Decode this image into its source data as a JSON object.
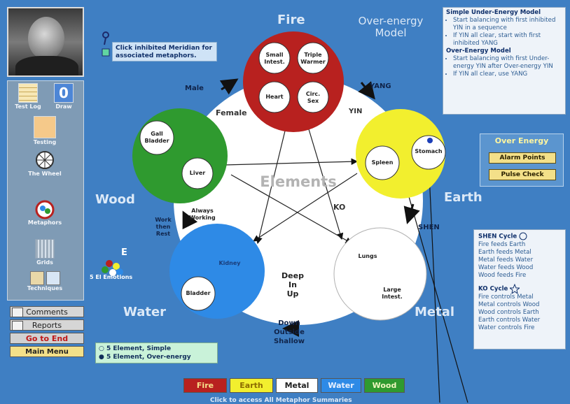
{
  "sidebar": {
    "tools": {
      "test_log": "Test Log",
      "draw": "Draw",
      "testing": "Testing",
      "the_wheel": "The Wheel",
      "metaphors": "Metaphors",
      "grids": "Grids",
      "techniques": "Techniques"
    },
    "emotions_label": "5 El Emotions",
    "emotions_badge": "E",
    "buttons": {
      "comments": "Comments",
      "reports": "Reports",
      "go_to_end": "Go to End",
      "main_menu": "Main Menu"
    }
  },
  "hint_note": "Click inhibited Meridian for associated metaphors.",
  "model_title": "Over-energy\nModel",
  "model_box": {
    "under_title": "Simple Under-Energy Model",
    "under_items": [
      "Start balancing with first inhibited YIN in a sequence",
      "If YIN all clear, start with first inhibited YANG"
    ],
    "over_title": "Over-Energy Model",
    "over_items": [
      "Start balancing with first Under-energy YIN after Over-energy YIN",
      "If YIN all clear, use YANG"
    ]
  },
  "over_energy": {
    "title": "Over Energy",
    "alarm": "Alarm Points",
    "pulse": "Pulse Check"
  },
  "cycle_box": {
    "shen_title": "SHEN Cycle",
    "shen_items": [
      "Fire feeds Earth",
      "Earth feeds Metal",
      "Metal feeds Water",
      "Water feeds Wood",
      "Wood feeds Fire"
    ],
    "ko_title": "KO Cycle",
    "ko_items": [
      "Fire controls Metal",
      "Metal controls Wood",
      "Wood controls Earth",
      "Earth controls Water",
      "Water controls Fire"
    ]
  },
  "wheel": {
    "center": "Elements",
    "elements": {
      "fire": "Fire",
      "earth": "Earth",
      "metal": "Metal",
      "water": "Water",
      "wood": "Wood"
    },
    "meridians": {
      "small_intestine": "Small\nIntest.",
      "triple_warmer": "Triple\nWarmer",
      "heart": "Heart",
      "circ_sex": "Circ.\nSex",
      "stomach": "Stomach",
      "spleen": "Spleen",
      "lungs": "Lungs",
      "large_intestine": "Large\nIntest.",
      "kidney": "Kidney",
      "bladder": "Bladder",
      "gall_bladder": "Gall\nBladder",
      "liver": "Liver"
    },
    "labels": {
      "male": "Male",
      "female": "Female",
      "yang": "YANG",
      "yin": "YIN",
      "ko": "KO",
      "shen": "SHEN",
      "always_working": "Always\nWorking",
      "work_then_rest": "Work\nthen\nRest",
      "deep_in_up": "Deep\nIn\nUp",
      "down_outside_shallow": "Down\nOutside\nShallow"
    }
  },
  "radio": {
    "simple": "5 Element, Simple",
    "over": "5 Element, Over-energy",
    "selected": "over"
  },
  "element_buttons": {
    "fire": "Fire",
    "earth": "Earth",
    "metal": "Metal",
    "water": "Water",
    "wood": "Wood"
  },
  "footer_hint": "Click to access All Metaphor Summaries",
  "colors": {
    "background": "#3f7fc3",
    "fire": "#b8211f",
    "earth": "#f2ef2e",
    "metal": "#ffffff",
    "water": "#2e8ae6",
    "wood": "#2f9a2f"
  }
}
